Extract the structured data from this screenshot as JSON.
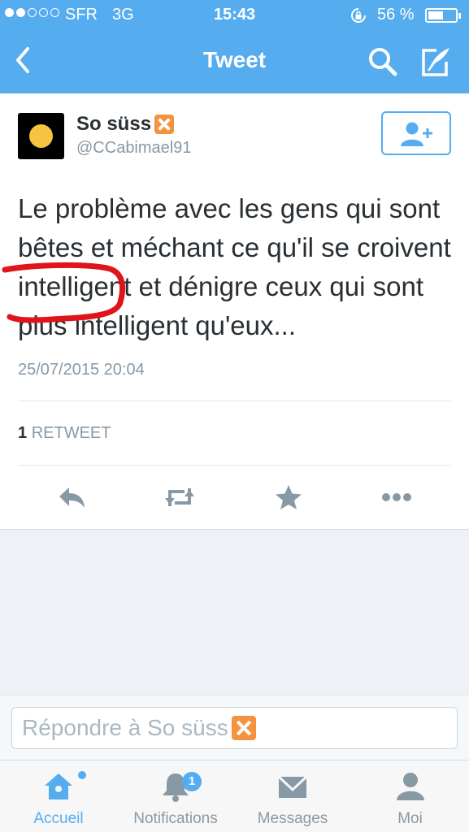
{
  "status_bar": {
    "carrier": "SFR",
    "network": "3G",
    "time": "15:43",
    "battery": "56 %",
    "battery_level": 0.56
  },
  "nav": {
    "title": "Tweet"
  },
  "tweet": {
    "author_name": "So süss",
    "author_handle": "@CCabimael91",
    "text": "Le problème avec les gens qui sont bêtes et méchant ce qu'il se croivent intelligent et dénigre ceux qui sont plus intelligent qu'eux...",
    "timestamp": "25/07/2015 20:04",
    "retweet_count": "1",
    "retweet_label": "RETWEET"
  },
  "reply": {
    "placeholder": "Répondre à So süss"
  },
  "tabs": [
    {
      "label": "Accueil",
      "icon": "home-icon",
      "active": true
    },
    {
      "label": "Notifications",
      "icon": "bell-icon",
      "badge": "1"
    },
    {
      "label": "Messages",
      "icon": "envelope-icon"
    },
    {
      "label": "Moi",
      "icon": "person-icon"
    }
  ],
  "colors": {
    "brand": "#55acee",
    "text": "#292f33",
    "muted": "#8899a6",
    "annotation": "#e0141b"
  }
}
